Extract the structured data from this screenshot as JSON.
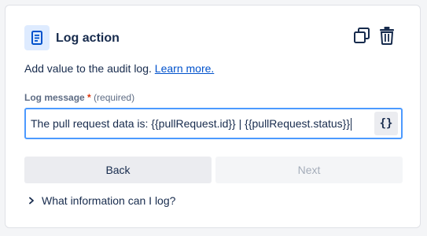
{
  "header": {
    "title": "Log action",
    "icon": "document-icon",
    "actions": [
      {
        "name": "duplicate",
        "icon": "copy-icon"
      },
      {
        "name": "delete",
        "icon": "trash-icon"
      }
    ]
  },
  "description": {
    "text": "Add value to the audit log. ",
    "link": "Learn more."
  },
  "field": {
    "label": "Log message",
    "required_marker": "*",
    "required_text": "(required)",
    "value": "The pull request data is: {{pullRequest.id}} | {{pullRequest.status}}",
    "smart_value_button": "{}"
  },
  "buttons": {
    "back": "Back",
    "next": "Next"
  },
  "disclosure": {
    "label": "What information can I log?"
  },
  "colors": {
    "accent": "#0052cc",
    "focus_border": "#4c9aff",
    "icon_badge_bg": "#deebff"
  }
}
